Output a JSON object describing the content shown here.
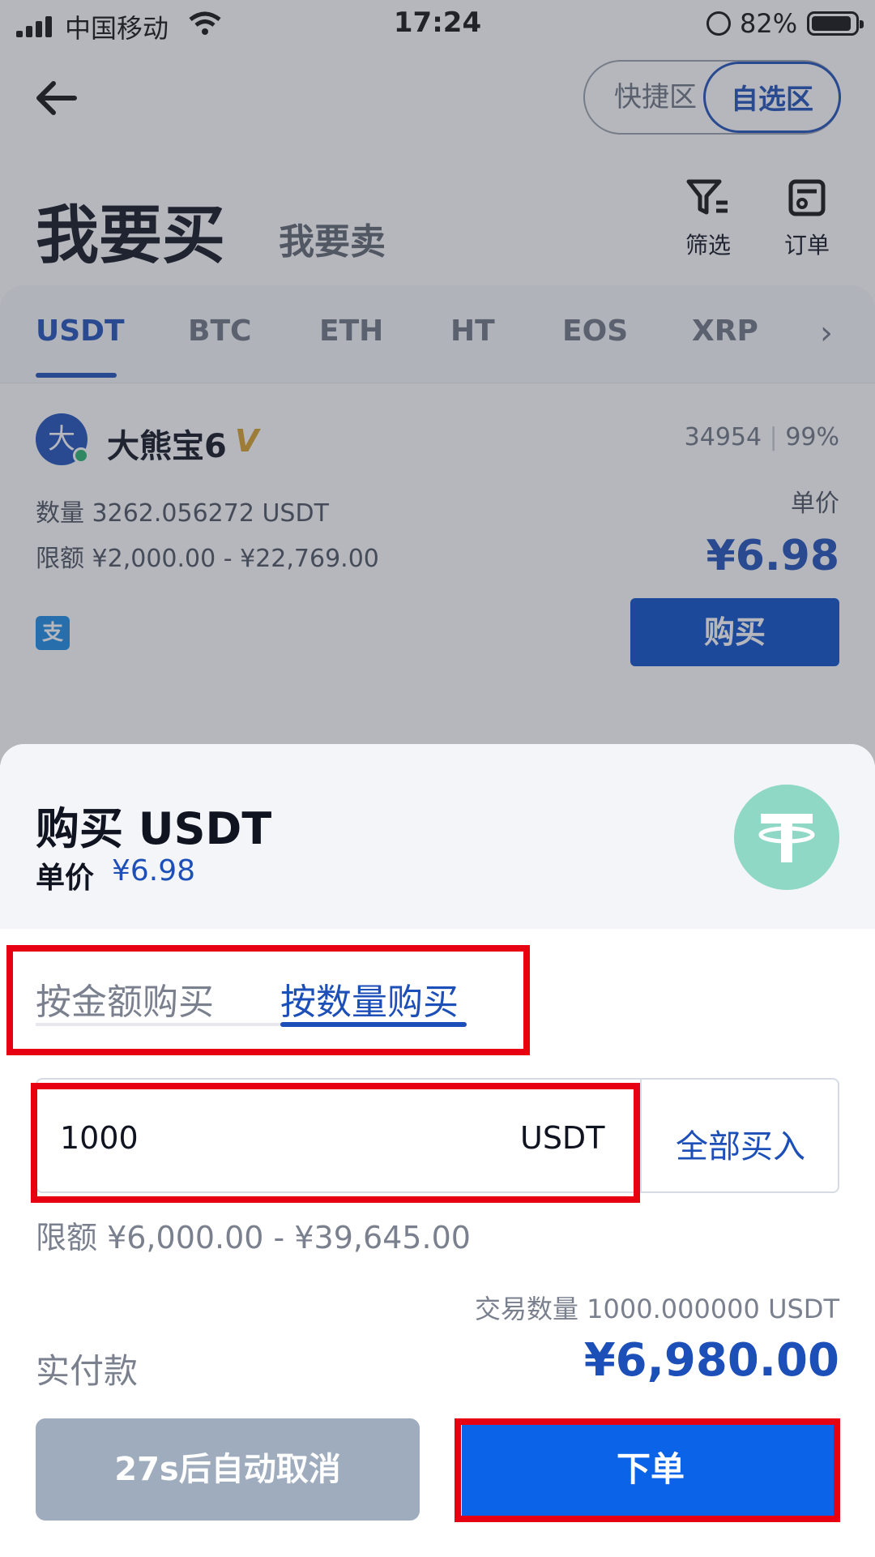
{
  "status_bar": {
    "carrier": "中国移动",
    "time": "17:24",
    "battery": "82%"
  },
  "header": {
    "zone_quick": "快捷区",
    "zone_self": "自选区"
  },
  "page": {
    "title_buy": "我要买",
    "title_sell": "我要卖",
    "filter": "筛选",
    "orders": "订单"
  },
  "coin_tabs": [
    "USDT",
    "BTC",
    "ETH",
    "HT",
    "EOS",
    "XRP"
  ],
  "listing": {
    "avatar_char": "大",
    "merchant": "大熊宝6",
    "badge": "V",
    "orders_count": "34954",
    "completion": "99%",
    "quantity": "数量 3262.056272 USDT",
    "limit": "限额 ¥2,000.00 - ¥22,769.00",
    "price_label": "单价",
    "price": "¥6.98",
    "pay_method": "支",
    "buy_label": "购买"
  },
  "sheet": {
    "title": "购买 USDT",
    "price_label": "单价",
    "price": "¥6.98",
    "mode_amount": "按金额购买",
    "mode_quantity": "按数量购买",
    "input_value": "1000",
    "input_unit": "USDT",
    "buy_all": "全部买入",
    "limit": "限额 ¥6,000.00 - ¥39,645.00",
    "trade_qty": "交易数量 1000.000000 USDT",
    "pay_label": "实付款",
    "pay_total": "¥6,980.00",
    "cancel_label": "27s后自动取消",
    "order_label": "下单"
  }
}
